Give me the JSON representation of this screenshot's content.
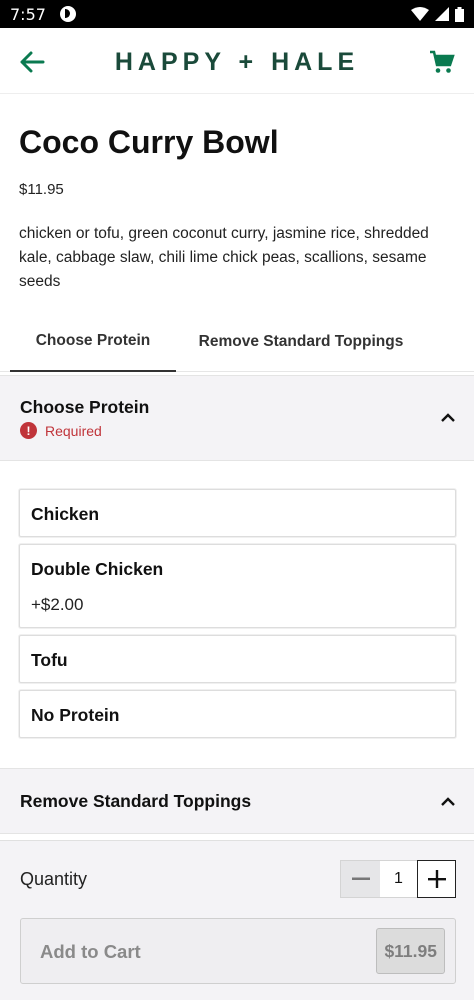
{
  "status_bar": {
    "time": "7:57"
  },
  "app_bar": {
    "logo_left": "HAPPY",
    "logo_plus": "+",
    "logo_right": "HALE"
  },
  "product": {
    "title": "Coco Curry Bowl",
    "price": "$11.95",
    "description": "chicken or tofu, green coconut curry, jasmine rice, shredded kale, cabbage slaw, chili lime chick peas, scallions, sesame seeds"
  },
  "tabs": [
    {
      "label": "Choose Protein",
      "active": true
    },
    {
      "label": "Remove Standard Toppings",
      "active": false
    }
  ],
  "protein_section": {
    "title": "Choose Protein",
    "required_label": "Required",
    "options": [
      {
        "label": "Chicken"
      },
      {
        "label": "Double Chicken",
        "price": "+$2.00"
      },
      {
        "label": "Tofu"
      },
      {
        "label": "No Protein"
      }
    ]
  },
  "toppings_section": {
    "title": "Remove Standard Toppings"
  },
  "order": {
    "quantity_label": "Quantity",
    "quantity": "1",
    "add_to_cart_label": "Add to Cart",
    "total": "$11.95"
  },
  "colors": {
    "brand": "#1a4a3a",
    "cart_icon": "#0a7a50",
    "required": "#c0343a"
  }
}
